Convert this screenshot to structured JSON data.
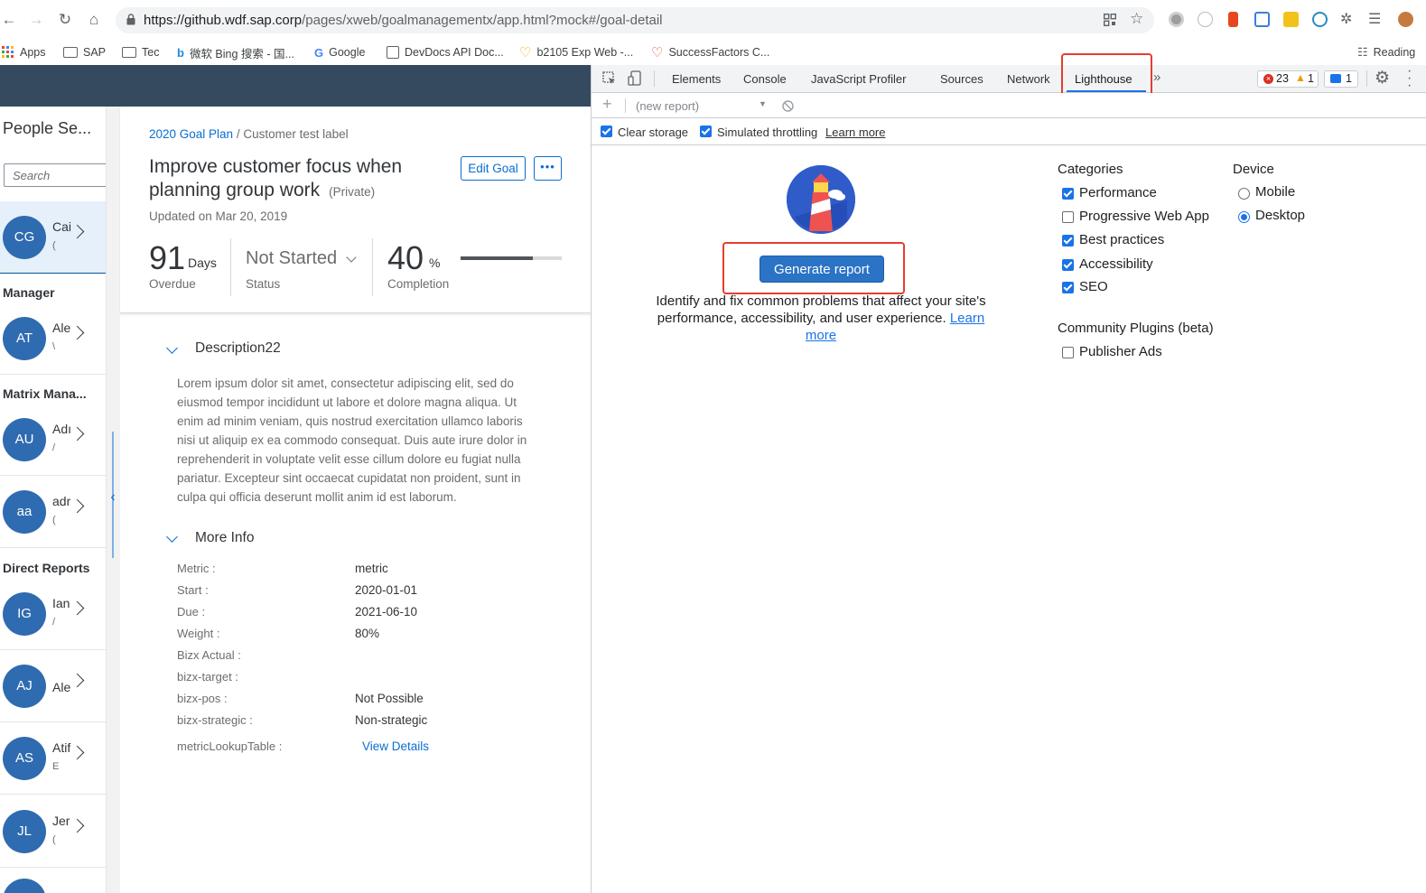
{
  "browser": {
    "url_host": "https://github.wdf.sap.corp",
    "url_path": "/pages/xweb/goalmanagementx/app.html?mock#/goal-detail",
    "bookmarks": [
      {
        "label": "Apps"
      },
      {
        "label": "SAP"
      },
      {
        "label": "Tec"
      },
      {
        "label": "微软 Bing 搜索 - 国..."
      },
      {
        "label": "Google"
      },
      {
        "label": "DevDocs API Doc..."
      },
      {
        "label": "b2105 Exp Web -..."
      },
      {
        "label": "SuccessFactors C..."
      }
    ],
    "reading_list": "Reading"
  },
  "people": {
    "title": "People Se...",
    "search_placeholder": "Search",
    "selected": {
      "initials": "CG",
      "name": "Cai",
      "sub": "("
    },
    "manager_header": "Manager",
    "manager": {
      "initials": "AT",
      "name": "Ale",
      "sub": "\\"
    },
    "matrix_header": "Matrix Mana...",
    "matrix": [
      {
        "initials": "AU",
        "name": "Adı",
        "sub": "/"
      },
      {
        "initials": "aa",
        "name": "adr",
        "sub": "("
      }
    ],
    "direct_header": "Direct Reports",
    "direct": [
      {
        "initials": "IG",
        "name": "Ian",
        "sub": "/"
      },
      {
        "initials": "AJ",
        "name": "Ale",
        "sub": ""
      },
      {
        "initials": "AS",
        "name": "Atif",
        "sub": "E"
      },
      {
        "initials": "JL",
        "name": "Jer",
        "sub": "("
      }
    ]
  },
  "goal": {
    "breadcrumb_link": "2020 Goal Plan",
    "breadcrumb_sep": "/",
    "breadcrumb_current": "Customer test label",
    "title": "Improve customer focus when planning group work",
    "privacy": "(Private)",
    "updated": "Updated on Mar 20, 2019",
    "edit_label": "Edit Goal",
    "more_label": "•••",
    "days_value": "91",
    "days_unit": "Days",
    "days_label": "Overdue",
    "status_value": "Not Started",
    "status_label": "Status",
    "completion_value": "40",
    "completion_unit": "%",
    "completion_label": "Completion",
    "progress_fraction": 0.71,
    "description_title": "Description22",
    "description": "Lorem ipsum dolor sit amet, consectetur adipiscing elit, sed do eiusmod tempor incididunt ut labore et dolore magna aliqua. Ut enim ad minim veniam, quis nostrud exercitation ullamco laboris nisi ut aliquip ex ea commodo consequat. Duis aute irure dolor in reprehenderit in voluptate velit esse cillum dolore eu fugiat nulla pariatur. Excepteur sint occaecat cupidatat non proident, sunt in culpa qui officia deserunt mollit anim id est laborum.",
    "more_info_title": "More Info",
    "more_info": [
      {
        "label": "Metric :",
        "value": "metric"
      },
      {
        "label": "Start :",
        "value": "2020-01-01"
      },
      {
        "label": "Due :",
        "value": "2021-06-10"
      },
      {
        "label": "Weight :",
        "value": "80%"
      },
      {
        "label": "Bizx Actual :",
        "value": ""
      },
      {
        "label": "bizx-target :",
        "value": ""
      },
      {
        "label": "bizx-pos :",
        "value": "Not Possible"
      },
      {
        "label": "bizx-strategic :",
        "value": "Non-strategic"
      }
    ],
    "lookup_label": "metricLookupTable :",
    "lookup_link": "View Details"
  },
  "devtools": {
    "tabs": [
      "Elements",
      "Console",
      "JavaScript Profiler",
      "Sources",
      "Network",
      "Lighthouse"
    ],
    "overflow": "»",
    "errors": "23",
    "warnings": "1",
    "messages": "1",
    "report_select": "(new report)",
    "clear_storage": "Clear storage",
    "simulated_throttling": "Simulated throttling",
    "learn_more": "Learn more",
    "generate_report": "Generate report",
    "intro_text": "Identify and fix common problems that affect your site's performance, accessibility, and user experience.",
    "intro_link": "Learn more",
    "categories_header": "Categories",
    "categories": [
      {
        "label": "Performance",
        "checked": true
      },
      {
        "label": "Progressive Web App",
        "checked": false
      },
      {
        "label": "Best practices",
        "checked": true
      },
      {
        "label": "Accessibility",
        "checked": true
      },
      {
        "label": "SEO",
        "checked": true
      }
    ],
    "device_header": "Device",
    "devices": [
      {
        "label": "Mobile",
        "selected": false
      },
      {
        "label": "Desktop",
        "selected": true
      }
    ],
    "plugins_header": "Community Plugins (beta)",
    "plugins": [
      {
        "label": "Publisher Ads",
        "checked": false
      }
    ]
  },
  "colors": {
    "shellbar": "#354a5f",
    "sap_blue": "#0a6ed1",
    "avatar": "#2f6bb0",
    "devtools_accent": "#1a73e8",
    "highlight": "#e53d30"
  }
}
